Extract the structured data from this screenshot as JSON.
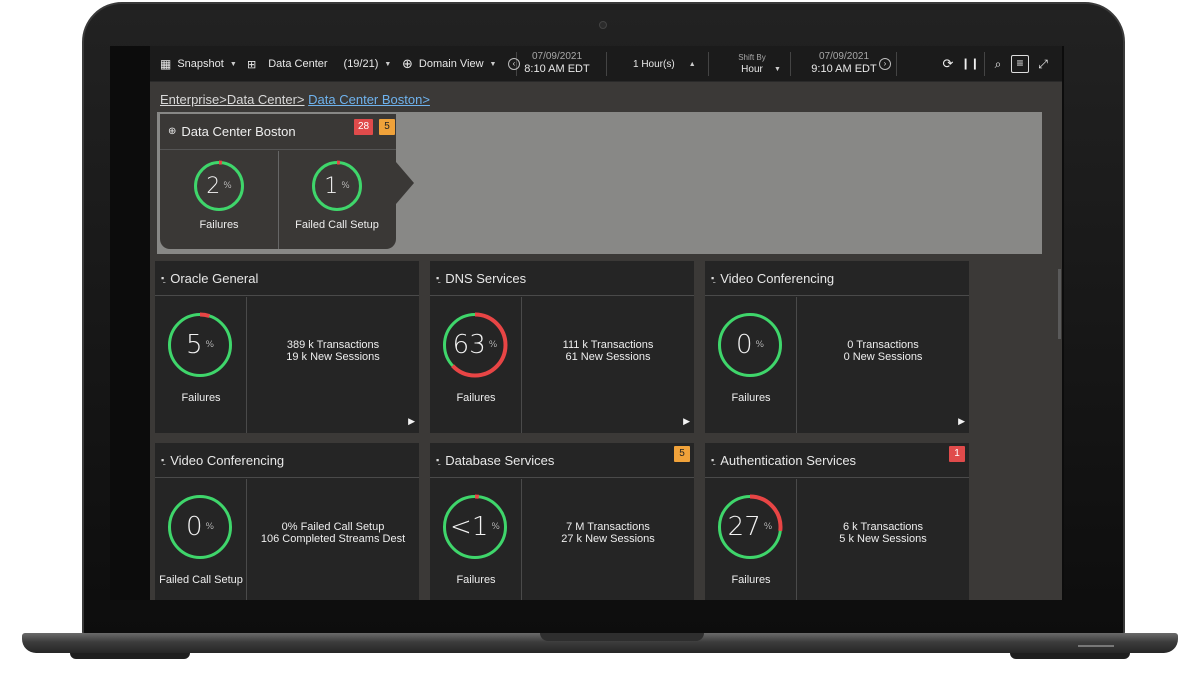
{
  "toolbar": {
    "snapshot_label": "Snapshot",
    "data_center_label": "Data Center",
    "data_center_count": "(19/21)",
    "domain_view_label": "Domain View",
    "start_date": "07/09/2021",
    "start_time": "8:10 AM EDT",
    "duration": "1 Hour(s)",
    "shift_by_label": "Shift By",
    "shift_by_value": "Hour",
    "end_date": "07/09/2021",
    "end_time": "9:10 AM EDT"
  },
  "breadcrumb": [
    "Enterprise>",
    "Data Center>",
    "Data Center Boston>"
  ],
  "cluster": {
    "title": "Data Center Boston",
    "badge_red": "28",
    "badge_amber": "5",
    "metrics": [
      {
        "value": "2",
        "unit": "%",
        "label": "Failures",
        "fraction": 0.02
      },
      {
        "value": "1",
        "unit": "%",
        "label": "Failed Call Setup",
        "fraction": 0.01
      }
    ]
  },
  "cards": [
    {
      "title": "Oracle General",
      "value": "5",
      "unit": "%",
      "fraction": 0.05,
      "label": "Failures",
      "line1": "389 k Transactions",
      "line2": "19 k New Sessions",
      "badge": "",
      "badge_type": ""
    },
    {
      "title": "DNS Services",
      "value": "63",
      "unit": "%",
      "fraction": 0.63,
      "label": "Failures",
      "line1": "111 k Transactions",
      "line2": "61 New Sessions",
      "badge": "",
      "badge_type": ""
    },
    {
      "title": "Video Conferencing",
      "value": "0",
      "unit": "%",
      "fraction": 0.0,
      "label": "Failures",
      "line1": "0 Transactions",
      "line2": "0 New Sessions",
      "badge": "",
      "badge_type": ""
    },
    {
      "title": "Video Conferencing",
      "value": "0",
      "unit": "%",
      "fraction": 0.0,
      "label": "Failed Call Setup",
      "line1": "0% Failed Call Setup",
      "line2": "106 Completed Streams Dest",
      "badge": "",
      "badge_type": ""
    },
    {
      "title": "Database Services",
      "value": "<1",
      "unit": "%",
      "fraction": 0.01,
      "label": "Failures",
      "line1": "7 M Transactions",
      "line2": "27 k New Sessions",
      "badge": "5",
      "badge_type": "amber"
    },
    {
      "title": "Authentication Services",
      "value": "27",
      "unit": "%",
      "fraction": 0.27,
      "label": "Failures",
      "line1": "6 k Transactions",
      "line2": "5 k New Sessions",
      "badge": "1",
      "badge_type": "red"
    }
  ],
  "colors": {
    "ok": "#3fd66b",
    "fail": "#e84545",
    "track": "#3a3a3a"
  },
  "icons": [
    "grid-icon",
    "hierarchy-icon",
    "globe-icon",
    "prev-icon",
    "next-icon",
    "refresh-icon",
    "pause-icon",
    "search-icon",
    "menu-icon",
    "fullscreen-icon",
    "node-icon",
    "play-arrow-icon"
  ]
}
